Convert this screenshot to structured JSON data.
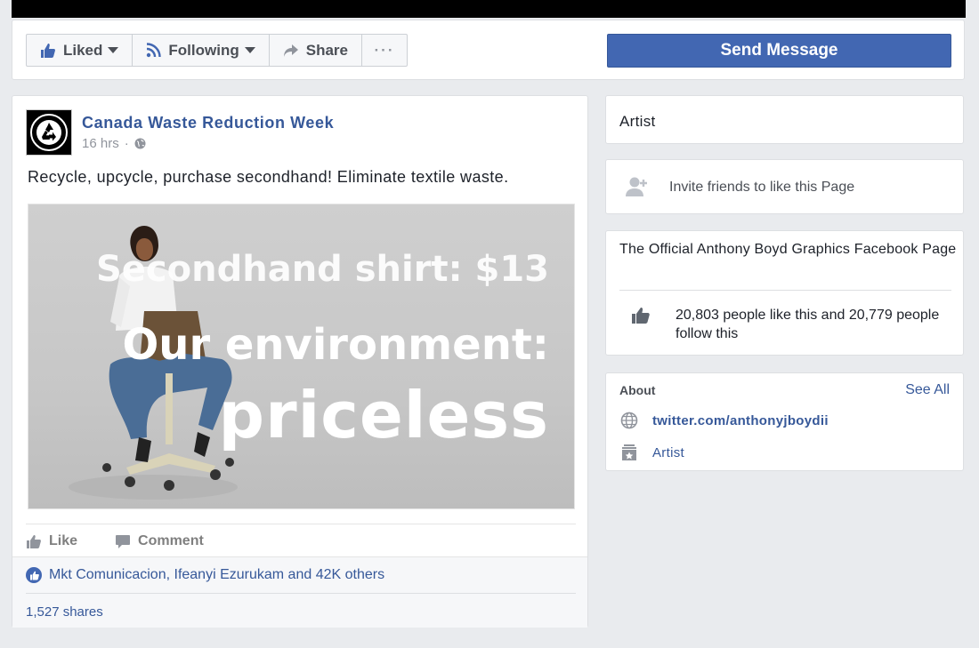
{
  "actions": {
    "liked": "Liked",
    "following": "Following",
    "share": "Share",
    "more": "···",
    "send_message": "Send Message"
  },
  "post": {
    "page_name": "Canada Waste Reduction Week",
    "time": "16 hrs",
    "separator": "·",
    "text": "Recycle, upcycle, purchase secondhand! Eliminate textile waste.",
    "image_lines": [
      "Secondhand shirt: $13",
      "Our environment:",
      "priceless"
    ],
    "like_label": "Like",
    "comment_label": "Comment",
    "reactions": "Mkt Comunicacion, Ifeanyi Ezurukam and 42K others",
    "shares": "1,527 shares"
  },
  "sidebar": {
    "category": "Artist",
    "invite": "Invite friends to like this Page",
    "description": "The Official Anthony Boyd Graphics Facebook Page",
    "likes_text": "20,803 people like this and 20,779 people follow this",
    "about": {
      "title": "About",
      "see_all": "See All",
      "website": "twitter.com/anthonyjboydii",
      "category": "Artist"
    }
  },
  "colors": {
    "brand_blue": "#4267b2",
    "link_blue": "#365899",
    "page_bg": "#e9ebee"
  }
}
